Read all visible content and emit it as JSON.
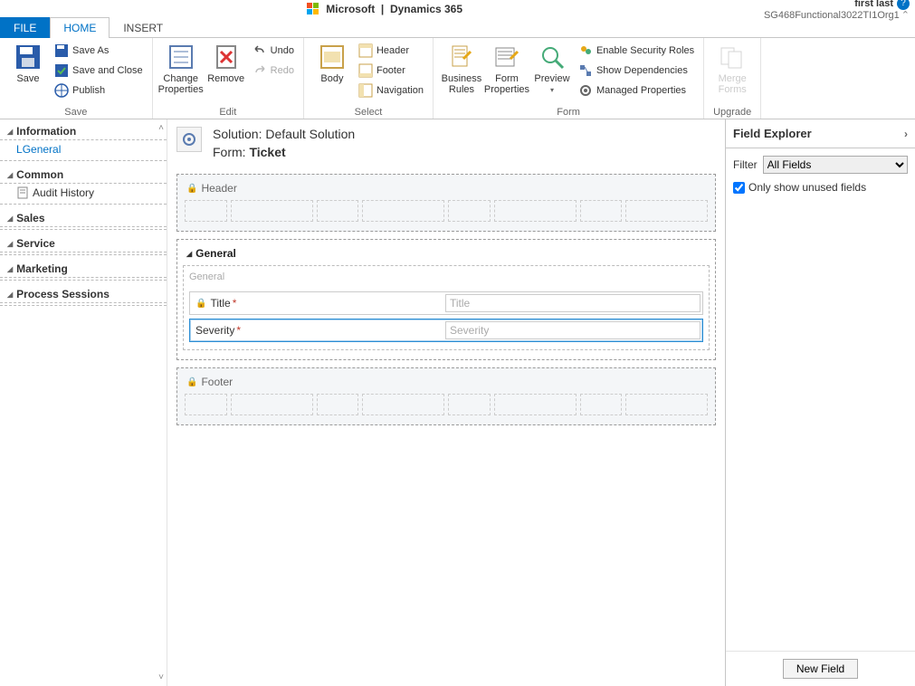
{
  "brand": {
    "company": "Microsoft",
    "product": "Dynamics 365",
    "user": "first last",
    "org": "SG468Functional3022TI1Org1"
  },
  "tabs": {
    "file": "FILE",
    "home": "HOME",
    "insert": "INSERT"
  },
  "ribbon": {
    "save": {
      "save": "Save",
      "save_as": "Save As",
      "save_close": "Save and Close",
      "publish": "Publish",
      "group": "Save"
    },
    "edit": {
      "change_props": "Change\nProperties",
      "remove": "Remove",
      "undo": "Undo",
      "redo": "Redo",
      "group": "Edit"
    },
    "select": {
      "body": "Body",
      "header": "Header",
      "footer": "Footer",
      "navigation": "Navigation",
      "group": "Select"
    },
    "form": {
      "biz_rules": "Business\nRules",
      "form_props": "Form\nProperties",
      "preview": "Preview",
      "enable_sec": "Enable Security Roles",
      "show_deps": "Show Dependencies",
      "managed_props": "Managed Properties",
      "group": "Form"
    },
    "upgrade": {
      "merge_forms": "Merge\nForms",
      "group": "Upgrade"
    }
  },
  "nav": {
    "information": "Information",
    "general_link": "General",
    "common": "Common",
    "audit_history": "Audit History",
    "sales": "Sales",
    "service": "Service",
    "marketing": "Marketing",
    "process_sessions": "Process Sessions"
  },
  "form_header": {
    "solution_label": "Solution:",
    "solution_name": "Default Solution",
    "form_label": "Form:",
    "form_name": "Ticket"
  },
  "canvas": {
    "header_section": "Header",
    "general_tab": "General",
    "general_section": "General",
    "footer_section": "Footer",
    "fields": {
      "title": {
        "label": "Title",
        "placeholder": "Title",
        "required": true,
        "locked": true
      },
      "severity": {
        "label": "Severity",
        "placeholder": "Severity",
        "required": true,
        "locked": false
      }
    }
  },
  "explorer": {
    "title": "Field Explorer",
    "filter_label": "Filter",
    "filter_value": "All Fields",
    "only_unused": "Only show unused fields",
    "new_field": "New Field"
  }
}
